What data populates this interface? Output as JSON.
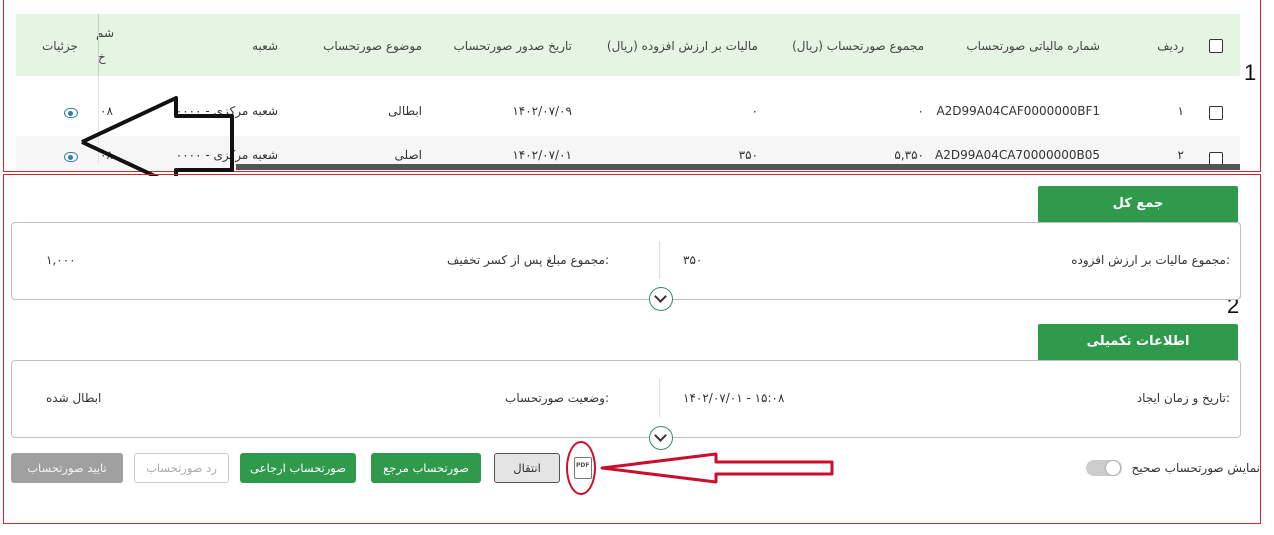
{
  "table": {
    "headers": {
      "select_all": "",
      "row_no": "ردیف",
      "tax_number": "شماره مالیاتی صورتحساب",
      "total": "مجموع صورتحساب (ریال)",
      "vat": "مالیات بر ارزش افزوده (ریال)",
      "issue_date": "تاریخ صدور صورتحساب",
      "subject": "موضوع صورتحساب",
      "branch": "شعبه",
      "cut_col_top": "شم",
      "cut_col_bottom": "خ",
      "details": "جزئیات"
    },
    "rows": [
      {
        "row_no": "۱",
        "tax_number": "A2D99A04CAF0000000BF1",
        "total": "۰",
        "vat": "۰",
        "issue_date": "۱۴۰۲/۰۷/۰۹",
        "subject": "ابطالی",
        "branch": "شعبه مرکزی - ۰۰۰۰",
        "cut": "۰۸"
      },
      {
        "row_no": "۲",
        "tax_number": "A2D99A04CA70000000B05",
        "total": "۵,۳۵۰",
        "vat": "۳۵۰",
        "issue_date": "۱۴۰۲/۰۷/۰۱",
        "subject": "اصلی",
        "branch": "شعبه مرکزی - ۰۰۰۰",
        "cut": "۰۸"
      }
    ]
  },
  "annotations": {
    "frame1": "1",
    "frame2": "2"
  },
  "summary": {
    "title": "جمع کل",
    "vat_label": "مجموع مالیات بر ارزش افزوده:",
    "vat_value": "۳۵۰",
    "net_label": "مجموع مبلغ پس از کسر تخفیف:",
    "net_value": "۱,۰۰۰"
  },
  "extra": {
    "title": "اطلاعات تکمیلی",
    "created_label": "تاریخ و زمان ایجاد:",
    "created_value": "۱۴۰۲/۰۷/۰۱ - ۱۵:۰۸",
    "status_label": "وضعیت صورتحساب:",
    "status_value": "ابطال شده"
  },
  "actions": {
    "confirm": "تایید صورتحساب",
    "reject": "رد صورتحساب",
    "return_invoice": "صورتحساب ارجاعی",
    "reference_invoice": "صورتحساب مرجع",
    "transfer": "انتقال",
    "pdf": "PDF",
    "show_correct_label": "نمایش صورتحساب صحیح :"
  },
  "colors": {
    "green": "#2f9a4c",
    "header_bg": "#e5f4e3",
    "annotation_red": "#d7262d",
    "eye": "#2f7fa8"
  }
}
